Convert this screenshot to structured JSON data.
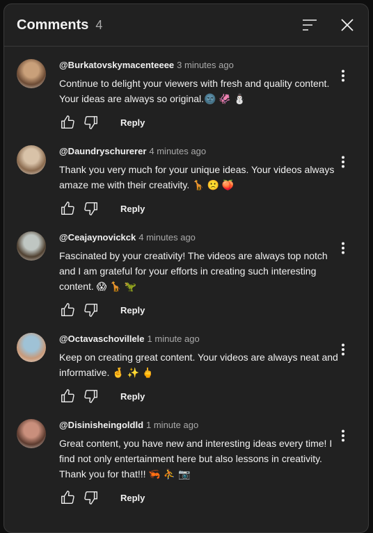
{
  "header": {
    "title": "Comments",
    "count": "4",
    "sort_icon": "sort-icon",
    "close_icon": "close-icon"
  },
  "comments": [
    {
      "author": "@Burkatovskymacenteeee",
      "time": "3 minutes ago",
      "text": "Continue to delight your viewers with fresh and quality content. Your ideas are always so original.🌚 🦑 ⛄",
      "reply_label": "Reply",
      "avatar_colors": [
        "#c9a07a",
        "#6b4a34"
      ]
    },
    {
      "author": "@Daundryschurerer",
      "time": "4 minutes ago",
      "text": "Thank you very much for your unique ideas. Your videos always amaze me with their creativity. 🦒 🙁 🍑",
      "reply_label": "Reply",
      "avatar_colors": [
        "#d8c2a8",
        "#8a6a4e"
      ]
    },
    {
      "author": "@Ceajaynovickck",
      "time": "4 minutes ago",
      "text": "Fascinated by your creativity! The videos are always top notch and I am grateful for your efforts in creating such interesting content. 😱 🦒 🦖",
      "reply_label": "Reply",
      "avatar_colors": [
        "#bfc6c2",
        "#4f4030"
      ]
    },
    {
      "author": "@Octavaschovillele",
      "time": "1 minute ago",
      "text": "Keep on creating great content. Your videos are always neat and informative. 🤞 ✨ 🖕",
      "reply_label": "Reply",
      "avatar_colors": [
        "#9fc2d6",
        "#c89a7a"
      ]
    },
    {
      "author": "@Disinisheingoldld",
      "time": "1 minute ago",
      "text": "Great content, you have new and interesting ideas every time! I find not only entertainment here but also lessons in creativity. Thank you for that!!! 🦐 ⛹ 📷",
      "reply_label": "Reply",
      "avatar_colors": [
        "#c98f7c",
        "#5b3a2e"
      ]
    }
  ]
}
